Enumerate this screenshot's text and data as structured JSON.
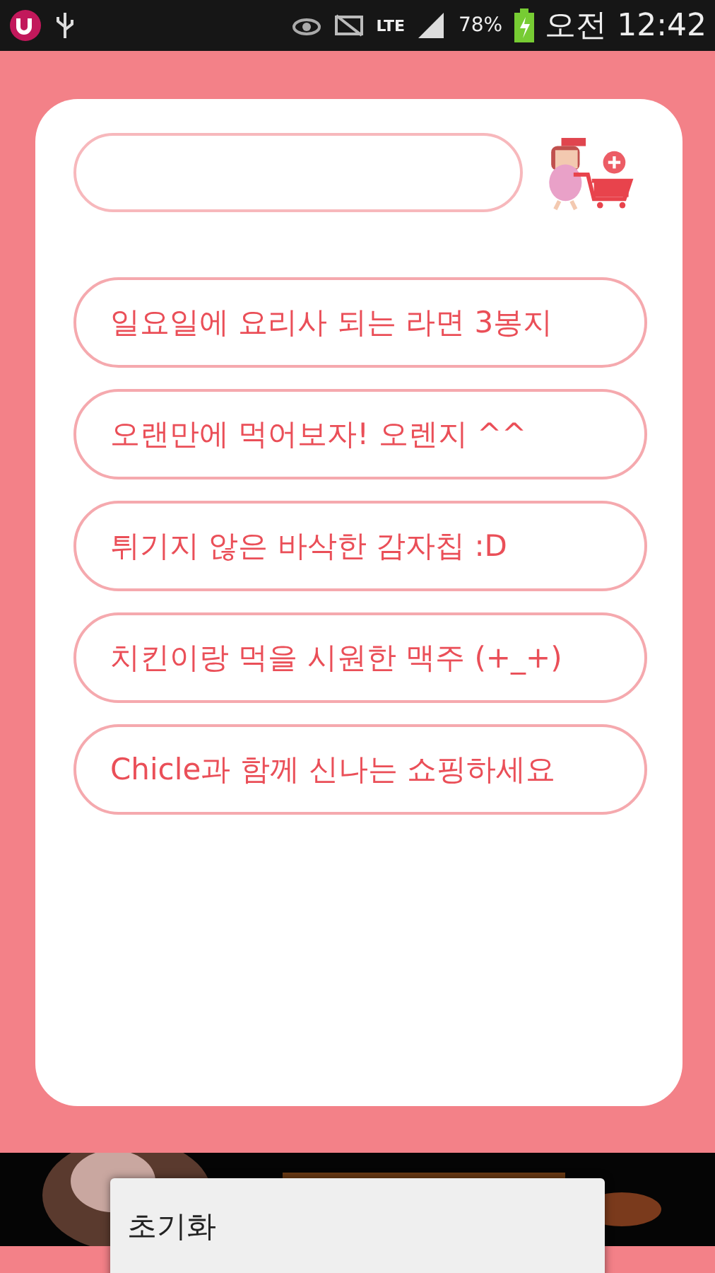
{
  "status_bar": {
    "network": "LTE",
    "battery": "78%",
    "time": "오전 12:42"
  },
  "items": [
    {
      "label": "일요일에 요리사 되는 라면 3봉지"
    },
    {
      "label": "오랜만에 먹어보자! 오렌지 ^^"
    },
    {
      "label": "튀기지 않은 바삭한 감자칩 :D"
    },
    {
      "label": "치킨이랑 먹을 시원한 맥주 (+_+)"
    },
    {
      "label": "Chicle과 함께 신나는 쇼핑하세요"
    }
  ],
  "menu": {
    "items": [
      "초기화"
    ]
  }
}
